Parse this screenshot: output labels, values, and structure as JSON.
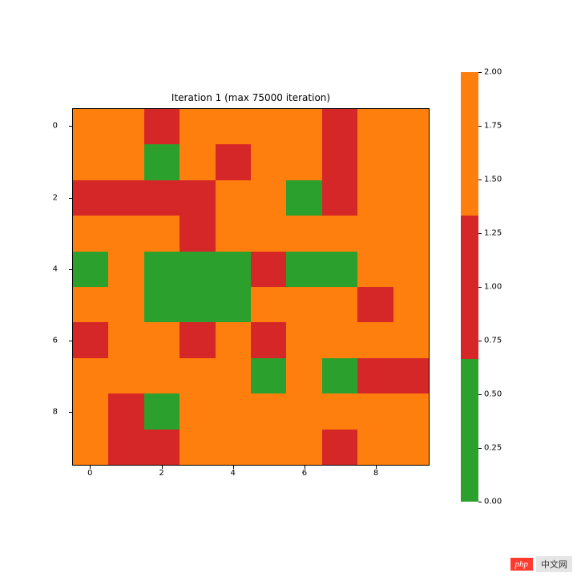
{
  "chart_data": {
    "type": "heatmap",
    "title": "Iteration 1 (max 75000 iteration)",
    "xlabel": "",
    "ylabel": "",
    "x_ticks": [
      0,
      2,
      4,
      6,
      8
    ],
    "y_ticks": [
      0,
      2,
      4,
      6,
      8
    ],
    "rows": 10,
    "cols": 10,
    "color_levels": {
      "0": {
        "label": "green",
        "hex": "#2ca02c"
      },
      "1": {
        "label": "red",
        "hex": "#d62728"
      },
      "2": {
        "label": "orange",
        "hex": "#ff7f0e"
      }
    },
    "grid": [
      [
        2,
        2,
        1,
        2,
        2,
        2,
        2,
        1,
        2,
        2
      ],
      [
        2,
        2,
        0,
        2,
        1,
        2,
        2,
        1,
        2,
        2
      ],
      [
        1,
        1,
        1,
        1,
        2,
        2,
        0,
        1,
        2,
        2
      ],
      [
        2,
        2,
        2,
        1,
        2,
        2,
        2,
        2,
        2,
        2
      ],
      [
        0,
        2,
        0,
        0,
        0,
        1,
        0,
        0,
        2,
        2
      ],
      [
        2,
        2,
        0,
        0,
        0,
        2,
        2,
        2,
        1,
        2
      ],
      [
        1,
        2,
        2,
        1,
        2,
        1,
        2,
        2,
        2,
        2
      ],
      [
        2,
        2,
        2,
        2,
        2,
        0,
        2,
        0,
        1,
        1
      ],
      [
        2,
        1,
        0,
        2,
        2,
        2,
        2,
        2,
        2,
        2
      ],
      [
        2,
        1,
        1,
        2,
        2,
        2,
        2,
        1,
        2,
        2
      ]
    ],
    "colorbar": {
      "min": 0.0,
      "max": 2.0,
      "ticks": [
        0.0,
        0.25,
        0.5,
        0.75,
        1.0,
        1.25,
        1.5,
        1.75,
        2.0
      ],
      "boundaries": [
        0.0,
        0.666,
        1.333,
        2.0
      ],
      "segments": [
        {
          "color": "#ff7f0e",
          "from": 2.0,
          "to": 1.333
        },
        {
          "color": "#d62728",
          "from": 1.333,
          "to": 0.666
        },
        {
          "color": "#2ca02c",
          "from": 0.666,
          "to": 0.0
        }
      ]
    }
  },
  "watermark": {
    "logo": "php",
    "text": "中文网"
  }
}
